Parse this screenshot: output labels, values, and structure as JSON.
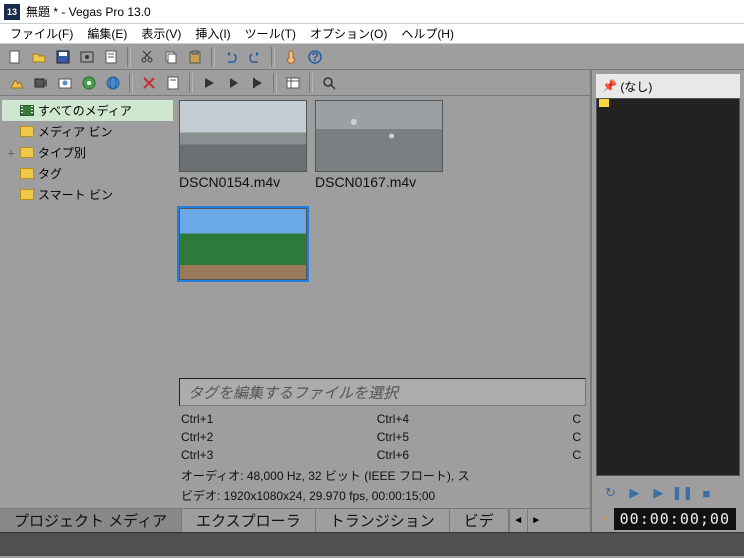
{
  "window": {
    "title": "無題 * - Vegas Pro 13.0",
    "app_icon_text": "13"
  },
  "menu": {
    "file": "ファイル(F)",
    "edit": "編集(E)",
    "view": "表示(V)",
    "insert": "挿入(I)",
    "tools": "ツール(T)",
    "options": "オプション(O)",
    "help": "ヘルプ(H)"
  },
  "tree": {
    "all_media": "すべてのメディア",
    "media_bin": "メディア ビン",
    "by_type": "タイプ別",
    "tags": "タグ",
    "smart_bin": "スマート ビン"
  },
  "thumbs": [
    {
      "label": "DSCN0154.m4v",
      "selected": false,
      "cls": "th1"
    },
    {
      "label": "DSCN0167.m4v",
      "selected": false,
      "cls": "th2"
    },
    {
      "label": "",
      "selected": true,
      "cls": "th3"
    }
  ],
  "tag_editor_placeholder": "タグを編集するファイルを選択",
  "shortcuts": {
    "c1": [
      "Ctrl+1",
      "Ctrl+2",
      "Ctrl+3"
    ],
    "c2": [
      "Ctrl+4",
      "Ctrl+5",
      "Ctrl+6"
    ],
    "c3": [
      "C",
      "C",
      "C"
    ]
  },
  "media_info": {
    "audio": "オーディオ: 48,000 Hz, 32 ビット (IEEE フロート), ス",
    "video": "ビデオ: 1920x1080x24, 29.970 fps, 00:00:15;00"
  },
  "tabs": {
    "project_media": "プロジェクト メディア",
    "explorer": "エクスプローラ",
    "transitions": "トランジション",
    "video": "ビデ"
  },
  "preview": {
    "list_label": "(なし)",
    "timecode": "00:00:00;00"
  }
}
